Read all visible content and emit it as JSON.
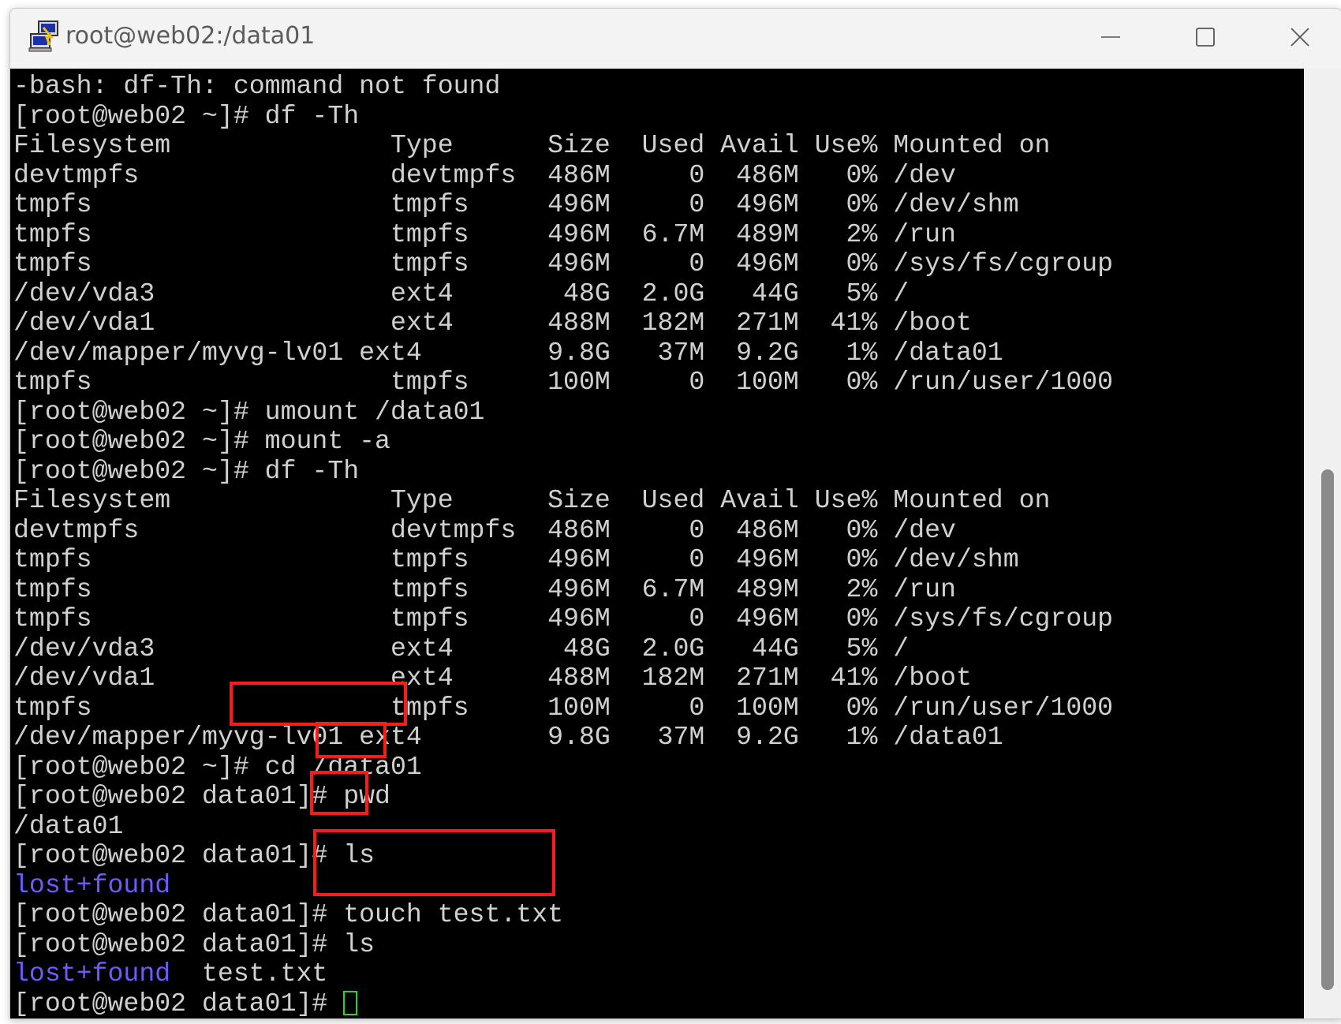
{
  "window": {
    "title": "root@web02:/data01"
  },
  "terminal": {
    "lines": [
      {
        "text": "-bash: df-Th: command not found"
      },
      {
        "text": "[root@web02 ~]# df -Th"
      },
      {
        "text": "Filesystem              Type      Size  Used Avail Use% Mounted on"
      },
      {
        "text": "devtmpfs                devtmpfs  486M     0  486M   0% /dev"
      },
      {
        "text": "tmpfs                   tmpfs     496M     0  496M   0% /dev/shm"
      },
      {
        "text": "tmpfs                   tmpfs     496M  6.7M  489M   2% /run"
      },
      {
        "text": "tmpfs                   tmpfs     496M     0  496M   0% /sys/fs/cgroup"
      },
      {
        "text": "/dev/vda3               ext4       48G  2.0G   44G   5% /"
      },
      {
        "text": "/dev/vda1               ext4      488M  182M  271M  41% /boot"
      },
      {
        "text": "/dev/mapper/myvg-lv01 ext4        9.8G   37M  9.2G   1% /data01"
      },
      {
        "text": "tmpfs                   tmpfs     100M     0  100M   0% /run/user/1000"
      },
      {
        "text": "[root@web02 ~]# umount /data01"
      },
      {
        "text": "[root@web02 ~]# mount -a"
      },
      {
        "text": "[root@web02 ~]# df -Th"
      },
      {
        "text": "Filesystem              Type      Size  Used Avail Use% Mounted on"
      },
      {
        "text": "devtmpfs                devtmpfs  486M     0  486M   0% /dev"
      },
      {
        "text": "tmpfs                   tmpfs     496M     0  496M   0% /dev/shm"
      },
      {
        "text": "tmpfs                   tmpfs     496M  6.7M  489M   2% /run"
      },
      {
        "text": "tmpfs                   tmpfs     496M     0  496M   0% /sys/fs/cgroup"
      },
      {
        "text": "/dev/vda3               ext4       48G  2.0G   44G   5% /"
      },
      {
        "text": "/dev/vda1               ext4      488M  182M  271M  41% /boot"
      },
      {
        "text": "tmpfs                   tmpfs     100M     0  100M   0% /run/user/1000"
      },
      {
        "text": "/dev/mapper/myvg-lv01 ext4        9.8G   37M  9.2G   1% /data01"
      },
      {
        "text": "[root@web02 ~]# cd /data01"
      },
      {
        "text": "[root@web02 data01]# pwd"
      },
      {
        "text": "/data01"
      },
      {
        "text": "[root@web02 data01]# ls"
      },
      {
        "text": "",
        "dir": "lost+found"
      },
      {
        "text": "[root@web02 data01]# touch test.txt"
      },
      {
        "text": "[root@web02 data01]# ls"
      },
      {
        "text": "  test.txt",
        "dir": "lost+found"
      },
      {
        "text": "[root@web02 data01]# ",
        "cursor": true
      }
    ]
  },
  "colors": {
    "terminal_bg": "#000000",
    "terminal_fg": "#d0d0d0",
    "directory": "#6a5cff",
    "cursor": "#28d628",
    "highlight_box": "#ff1a1a"
  },
  "icons": {
    "app": "putty-terminal-icon",
    "minimize": "minimize-icon",
    "maximize": "maximize-icon",
    "close": "close-icon"
  }
}
